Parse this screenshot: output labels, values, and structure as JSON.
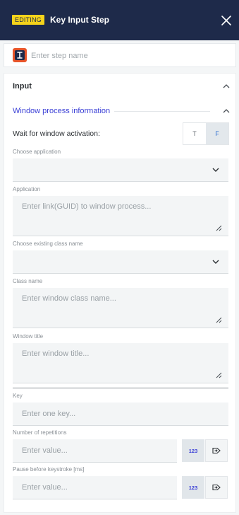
{
  "header": {
    "badge": "EDITING",
    "title": "Key Input Step"
  },
  "step_name": {
    "placeholder": "Enter step name",
    "value": ""
  },
  "input_section": {
    "title": "Input",
    "subsection_title": "Window process information",
    "wait_label": "Wait for window activation:",
    "toggle": {
      "true_label": "T",
      "false_label": "F",
      "selected": "F"
    },
    "choose_application_label": "Choose application",
    "application_label": "Application",
    "application_placeholder": "Enter link(GUID) to window process...",
    "choose_class_label": "Choose existing class name",
    "class_name_label": "Class name",
    "class_name_placeholder": "Enter window class name...",
    "window_title_label": "Window title",
    "window_title_placeholder": "Enter window title...",
    "key_label": "Key",
    "key_placeholder": "Enter one key...",
    "repetitions_label": "Number of repetitions",
    "repetitions_placeholder": "Enter value...",
    "pause_label": "Pause before keystroke [ms]",
    "pause_placeholder": "Enter value...",
    "numeric_button_label": "123"
  },
  "icons": {
    "close": "close-icon",
    "step": "key-input-step-icon",
    "collapse": "chevron-up-icon",
    "dropdown": "chevron-down-icon",
    "variable": "variable-arrow-icon"
  },
  "colors": {
    "header_bg": "#1e2a4a",
    "badge_bg": "#f5d31b",
    "accent": "#3a3fd6",
    "step_icon": "#e8552a"
  }
}
